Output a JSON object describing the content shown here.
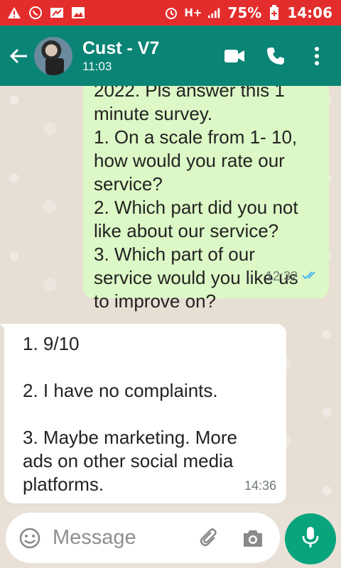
{
  "status_bar": {
    "battery": "75%",
    "time": "14:06",
    "network": "H+",
    "icons": [
      "warning-icon",
      "whatsapp-icon",
      "message-icon",
      "image-icon",
      "alarm-icon",
      "signal-icon",
      "battery-icon"
    ]
  },
  "header": {
    "title": "Cust - V7",
    "subtitle": "11:03",
    "icons": [
      "back-arrow-icon",
      "video-call-icon",
      "phone-icon",
      "more-options-icon"
    ],
    "color": "#0a8474"
  },
  "messages": [
    {
      "direction": "outgoing",
      "lines": [
        "2022. Pls answer this 1",
        "minute survey.",
        "1. On a scale from 1- 10,",
        "how would you rate our",
        "service?",
        "2. Which part did you not",
        "like about our service?",
        "3. Which part of our",
        "service would you like us",
        "to improve on?"
      ],
      "time": "12:32",
      "status": "read"
    },
    {
      "direction": "incoming",
      "lines": [
        "1. 9/10",
        "",
        "2. I have no complaints.",
        "",
        "3. Maybe marketing. More",
        "ads on other social media",
        "platforms."
      ],
      "time": "14:36"
    }
  ],
  "composer": {
    "placeholder": "Message",
    "icons": [
      "emoji-icon",
      "attach-icon",
      "camera-icon",
      "mic-icon"
    ],
    "accent": "#07a47d"
  }
}
